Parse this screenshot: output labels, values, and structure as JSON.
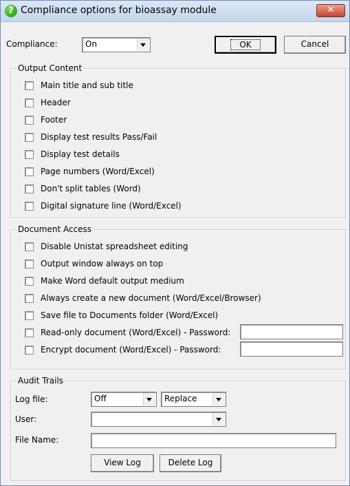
{
  "window": {
    "title": "Compliance options for bioassay module",
    "close_label": "✕"
  },
  "compliance": {
    "label": "Compliance:",
    "value": "On"
  },
  "buttons": {
    "ok": "OK",
    "cancel": "Cancel"
  },
  "output_content": {
    "title": "Output Content",
    "items": [
      "Main title and sub title",
      "Header",
      "Footer",
      "Display test results Pass/Fail",
      "Display test details",
      "Page numbers (Word/Excel)",
      "Don't split tables (Word)",
      "Digital signature line (Word/Excel)"
    ]
  },
  "document_access": {
    "title": "Document Access",
    "items": [
      "Disable Unistat spreadsheet editing",
      "Output window always on top",
      "Make Word default output medium",
      "Always create a new document (Word/Excel/Browser)",
      "Save file to Documents folder (Word/Excel)",
      "Read-only document (Word/Excel) - Password:",
      "Encrypt document (Word/Excel) - Password:"
    ]
  },
  "audit_trails": {
    "title": "Audit Trails",
    "log_file_label": "Log file:",
    "log_file_value": "Off",
    "log_mode_value": "Replace",
    "user_label": "User:",
    "user_value": "",
    "file_name_label": "File Name:",
    "file_name_value": "",
    "view_log": "View Log",
    "delete_log": "Delete Log"
  }
}
